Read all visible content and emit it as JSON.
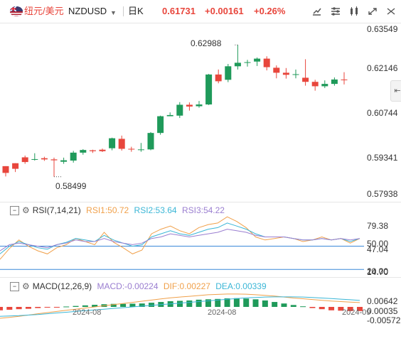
{
  "header": {
    "pair_cn": "纽元/美元",
    "symbol": "NZDUSD",
    "period": "日K",
    "last_price": "0.61731",
    "change": "+0.00161",
    "change_pct": "+0.26%",
    "icons": [
      "draw-tool-icon",
      "indicator-icon",
      "compare-icon",
      "fullscreen-icon",
      "settings-icon"
    ]
  },
  "price_axis": {
    "labels": [
      "0.63549",
      "0.62146",
      "0.60744",
      "0.59341",
      "0.57938"
    ]
  },
  "annotations": {
    "high": "0.62988",
    "low": "0.58499"
  },
  "rsi": {
    "name": "RSI(7,14,21)",
    "rsi1": "RSI1:50.72",
    "rsi2": "RSI2:53.64",
    "rsi3": "RSI3:54.22",
    "axis": [
      "79.38",
      "50.00",
      "47.04",
      "20.00",
      "14.70"
    ]
  },
  "macd": {
    "name": "MACD(12,26,9)",
    "macd": "MACD:-0.00224",
    "dif": "DIF:0.00227",
    "dea": "DEA:0.00339",
    "axis": [
      "0.00642",
      "0.00035",
      "-0.00572"
    ]
  },
  "dates": [
    "2024-08",
    "2024-08",
    "2024-09"
  ],
  "colors": {
    "up": "#e8463c",
    "down": "#1f9a5a",
    "rsi1": "#f0a04a",
    "rsi2": "#3ab6d6",
    "rsi3": "#9a7ed0",
    "dif": "#f0a04a",
    "dea": "#3ab6d6",
    "ref_line": "#3a88d8"
  },
  "chart_data": {
    "type": "candlestick",
    "ohlc": [
      [
        0.5886,
        0.5886,
        0.5851,
        0.5863
      ],
      [
        0.5896,
        0.5896,
        0.5866,
        0.5877
      ],
      [
        0.5916,
        0.5922,
        0.5894,
        0.59
      ],
      [
        0.5909,
        0.593,
        0.5905,
        0.591
      ],
      [
        0.5913,
        0.5918,
        0.5904,
        0.5909
      ],
      [
        0.5909,
        0.5915,
        0.585,
        0.5906
      ],
      [
        0.5901,
        0.5915,
        0.5894,
        0.5906
      ],
      [
        0.5905,
        0.5938,
        0.5898,
        0.5932
      ],
      [
        0.5932,
        0.5944,
        0.5925,
        0.5941
      ],
      [
        0.594,
        0.5942,
        0.5931,
        0.5937
      ],
      [
        0.5942,
        0.5946,
        0.5934,
        0.5937
      ],
      [
        0.5947,
        0.5983,
        0.594,
        0.5981
      ],
      [
        0.5979,
        0.599,
        0.5939,
        0.5945
      ],
      [
        0.5945,
        0.5952,
        0.5935,
        0.5943
      ],
      [
        0.5943,
        0.5965,
        0.5935,
        0.5943
      ],
      [
        0.5943,
        0.6002,
        0.594,
        0.5999
      ],
      [
        0.5999,
        0.6058,
        0.5993,
        0.6056
      ],
      [
        0.6056,
        0.6069,
        0.6058,
        0.606
      ],
      [
        0.6058,
        0.6104,
        0.605,
        0.6095
      ],
      [
        0.6095,
        0.6103,
        0.6075,
        0.6089
      ],
      [
        0.609,
        0.6108,
        0.6085,
        0.6096
      ],
      [
        0.6096,
        0.62,
        0.6094,
        0.6198
      ],
      [
        0.6198,
        0.6215,
        0.6168,
        0.6175
      ],
      [
        0.618,
        0.6234,
        0.6172,
        0.6226
      ],
      [
        0.6226,
        0.6299,
        0.6215,
        0.6238
      ],
      [
        0.6238,
        0.6248,
        0.6225,
        0.624
      ],
      [
        0.6242,
        0.6256,
        0.6227,
        0.6252
      ],
      [
        0.6252,
        0.626,
        0.6212,
        0.6223
      ],
      [
        0.6221,
        0.6229,
        0.6185,
        0.6204
      ],
      [
        0.6204,
        0.622,
        0.6184,
        0.6197
      ],
      [
        0.6197,
        0.6215,
        0.6185,
        0.6199
      ],
      [
        0.6187,
        0.625,
        0.616,
        0.6173
      ],
      [
        0.6173,
        0.618,
        0.6143,
        0.6158
      ],
      [
        0.6158,
        0.6178,
        0.6152,
        0.6166
      ],
      [
        0.6166,
        0.6188,
        0.616,
        0.6181
      ],
      [
        0.6181,
        0.6206,
        0.6164,
        0.6179
      ]
    ],
    "price_range": [
      0.57938,
      0.63549
    ],
    "rsi1": [
      33,
      47,
      58,
      50,
      44,
      40,
      48,
      52,
      60,
      56,
      52,
      68,
      55,
      48,
      40,
      45,
      66,
      72,
      76,
      70,
      66,
      74,
      78,
      80,
      88,
      82,
      74,
      62,
      58,
      60,
      62,
      60,
      56,
      58,
      62,
      58,
      60,
      54,
      60
    ],
    "rsi2": [
      40,
      50,
      56,
      52,
      48,
      46,
      52,
      55,
      60,
      58,
      56,
      64,
      58,
      54,
      50,
      52,
      62,
      66,
      70,
      66,
      64,
      68,
      72,
      74,
      80,
      76,
      72,
      66,
      62,
      62,
      62,
      60,
      58,
      58,
      60,
      58,
      60,
      56,
      60
    ],
    "rsi3": [
      44,
      52,
      54,
      52,
      50,
      48,
      52,
      54,
      58,
      56,
      56,
      60,
      56,
      54,
      52,
      54,
      60,
      62,
      66,
      64,
      62,
      64,
      66,
      68,
      72,
      70,
      68,
      64,
      62,
      62,
      62,
      60,
      58,
      58,
      60,
      58,
      60,
      58,
      60
    ],
    "rsi_range": [
      14.7,
      90
    ],
    "macd_hist": [
      -0.0018,
      -0.0015,
      -0.0012,
      -0.001,
      -0.0006,
      -0.0003,
      -0.0001,
      0.0002,
      0.0005,
      0.0008,
      0.0011,
      0.0014,
      0.0016,
      0.0016,
      0.0017,
      0.0018,
      0.0022,
      0.0026,
      0.003,
      0.0032,
      0.0034,
      0.0038,
      0.004,
      0.0042,
      0.0045,
      0.0046,
      0.0044,
      0.004,
      0.0034,
      0.0026,
      0.0018,
      0.001,
      0.0003,
      -0.0006,
      -0.0012,
      -0.0018,
      -0.002,
      -0.0022,
      -0.0022
    ],
    "dif": [
      -0.006,
      -0.0055,
      -0.005,
      -0.0043,
      -0.0036,
      -0.003,
      -0.0024,
      -0.0018,
      -0.0012,
      -0.0006,
      0.0,
      0.0006,
      0.0012,
      0.0018,
      0.0024,
      0.003,
      0.0036,
      0.0042,
      0.0048,
      0.0052,
      0.0056,
      0.006,
      0.0064,
      0.0066,
      0.0068,
      0.0068,
      0.0067,
      0.0064,
      0.0061,
      0.0057,
      0.0052,
      0.0047,
      0.0043,
      0.0039,
      0.0035,
      0.0031,
      0.0028,
      0.0025,
      0.0023
    ],
    "dea": [
      -0.005,
      -0.0048,
      -0.0046,
      -0.0043,
      -0.004,
      -0.0036,
      -0.0032,
      -0.0028,
      -0.0024,
      -0.002,
      -0.0016,
      -0.0012,
      -0.0008,
      -0.0004,
      0.0,
      0.0004,
      0.0008,
      0.0012,
      0.0016,
      0.002,
      0.0024,
      0.0028,
      0.0032,
      0.0036,
      0.004,
      0.0044,
      0.0048,
      0.005,
      0.0052,
      0.0053,
      0.0053,
      0.0053,
      0.0052,
      0.005,
      0.0047,
      0.0044,
      0.0041,
      0.0038,
      0.0034
    ],
    "macd_range": [
      -0.0075,
      0.0075
    ]
  }
}
